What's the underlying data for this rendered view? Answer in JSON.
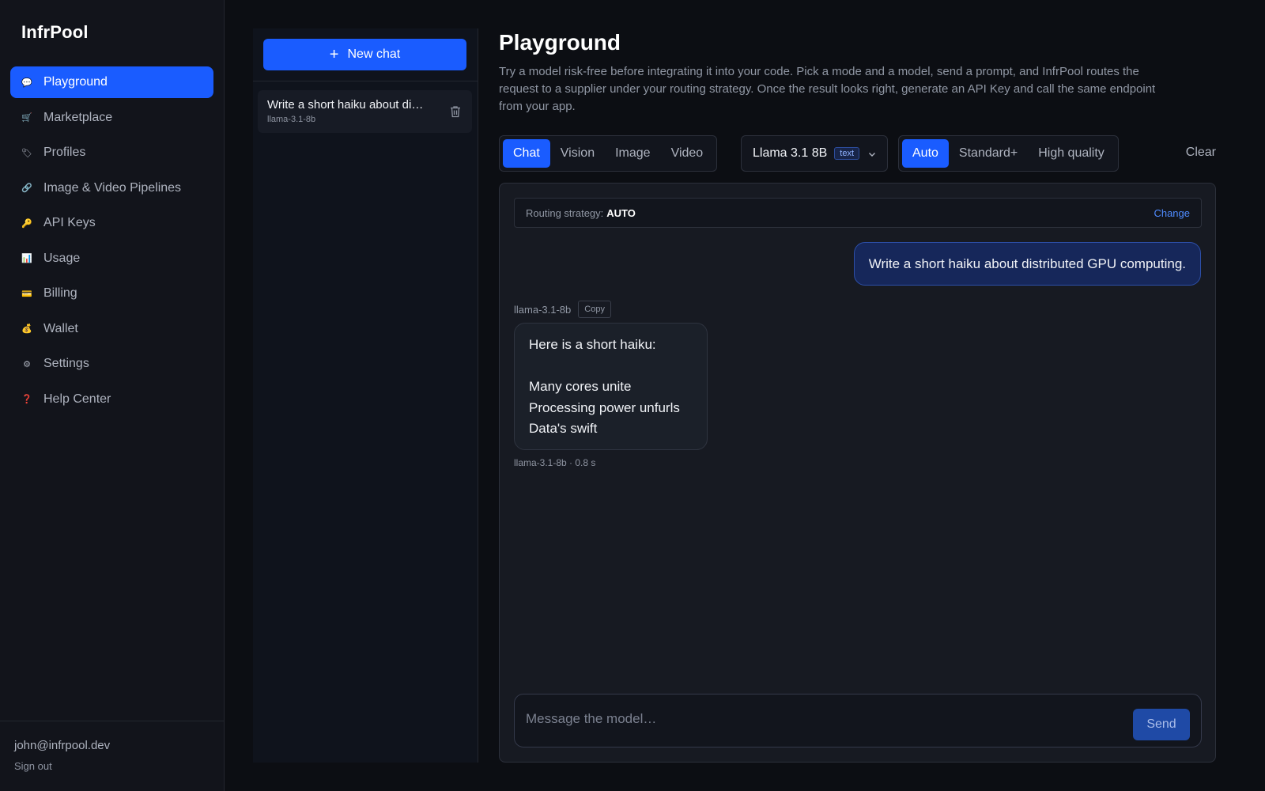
{
  "app": {
    "brand": "InfrPool"
  },
  "sidebar": {
    "items": [
      {
        "label": "Playground",
        "icon": "speech-bubble-icon",
        "glyph": "💬",
        "active": true
      },
      {
        "label": "Marketplace",
        "icon": "cart-icon",
        "glyph": "🛒",
        "active": false
      },
      {
        "label": "Profiles",
        "icon": "tag-icon",
        "glyph": "🏷",
        "active": false
      },
      {
        "label": "Image & Video Pipelines",
        "icon": "link-icon",
        "glyph": "🔗",
        "active": false
      },
      {
        "label": "API Keys",
        "icon": "key-icon",
        "glyph": "🔑",
        "active": false
      },
      {
        "label": "Usage",
        "icon": "bar-chart-icon",
        "glyph": "📊",
        "active": false
      },
      {
        "label": "Billing",
        "icon": "credit-card-icon",
        "glyph": "💳",
        "active": false
      },
      {
        "label": "Wallet",
        "icon": "money-bag-icon",
        "glyph": "💰",
        "active": false
      },
      {
        "label": "Settings",
        "icon": "gear-icon",
        "glyph": "⚙",
        "active": false
      },
      {
        "label": "Help Center",
        "icon": "question-icon",
        "glyph": "❓",
        "active": false
      }
    ],
    "user_email": "john@infrpool.dev",
    "sign_out": "Sign out"
  },
  "chatlist": {
    "new_chat_label": "New chat",
    "items": [
      {
        "title": "Write a short haiku about di…",
        "model": "llama-3.1-8b"
      }
    ]
  },
  "main": {
    "title": "Playground",
    "description": "Try a model risk-free before integrating it into your code. Pick a mode and a model, send a prompt, and InfrPool routes the request to a supplier under your routing strategy. Once the result looks right, generate an API Key and call the same endpoint from your app.",
    "modes": [
      {
        "label": "Chat",
        "active": true
      },
      {
        "label": "Vision",
        "active": false
      },
      {
        "label": "Image",
        "active": false
      },
      {
        "label": "Video",
        "active": false
      }
    ],
    "model": {
      "name": "Llama 3.1 8B",
      "tag": "text"
    },
    "quality": [
      {
        "label": "Auto",
        "active": true
      },
      {
        "label": "Standard+",
        "active": false
      },
      {
        "label": "High quality",
        "active": false
      }
    ],
    "clear_label": "Clear"
  },
  "chat": {
    "routing_label": "Routing strategy:",
    "routing_value": "AUTO",
    "change_label": "Change",
    "user_message": "Write a short haiku about distributed GPU computing.",
    "response_model": "llama-3.1-8b",
    "copy_label": "Copy",
    "response_lines": [
      "Here is a short haiku:",
      "",
      "Many cores unite",
      "Processing power unfurls",
      "Data's swift"
    ],
    "response_footer": "llama-3.1-8b · 0.8 s",
    "composer_placeholder": "Message the model…",
    "send_label": "Send"
  },
  "colors": {
    "accent": "#1a5cff",
    "background": "#0c0e13",
    "sidebar": "#12141b",
    "user_bubble": "#16275a"
  }
}
